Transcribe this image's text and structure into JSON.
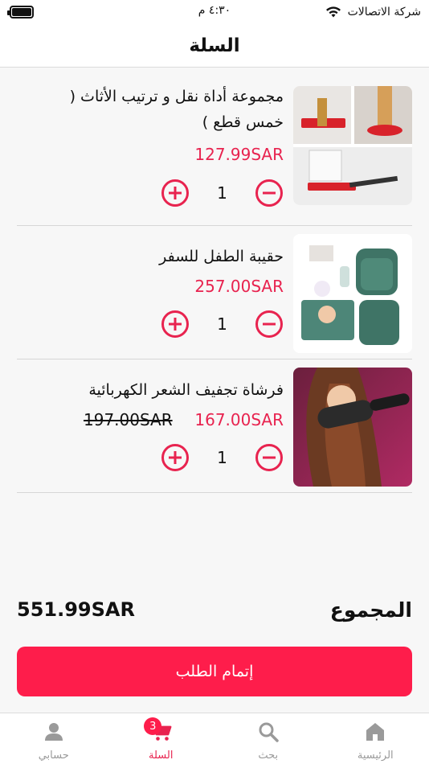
{
  "status_bar": {
    "carrier": "شركة الاتصالات",
    "time": "٤:٣٠ م"
  },
  "header": {
    "title": "السلة"
  },
  "cart": {
    "items": [
      {
        "name": "مجموعة أداة نقل و ترتيب الأثاث ( خمس قطع )",
        "price": "127.99SAR",
        "quantity": "1",
        "image": "furniture-mover-tool-image"
      },
      {
        "name": "حقيبة الطفل للسفر",
        "price": "257.00SAR",
        "quantity": "1",
        "image": "baby-travel-bag-image"
      },
      {
        "name": "فرشاة تجفيف الشعر الكهربائية",
        "price": "167.00SAR",
        "old_price": "197.00SAR",
        "quantity": "1",
        "image": "hair-dryer-brush-image"
      }
    ]
  },
  "summary": {
    "total_label": "المجموع",
    "total_value": "551.99SAR",
    "checkout_label": "إتمام الطلب"
  },
  "tabs": [
    {
      "label": "الرئيسية",
      "icon": "home-icon"
    },
    {
      "label": "بحث",
      "icon": "search-icon"
    },
    {
      "label": "السلة",
      "icon": "cart-icon",
      "badge": "3",
      "active": true
    },
    {
      "label": "حسابي",
      "icon": "user-icon"
    }
  ],
  "colors": {
    "accent": "#fe1d4b",
    "price": "#e8234f",
    "inactive_tab": "#9a9a9a"
  }
}
